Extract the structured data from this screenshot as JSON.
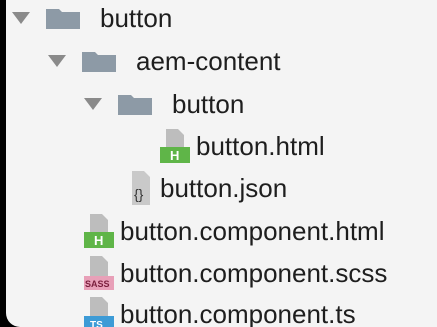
{
  "tree": {
    "root": {
      "label": "button"
    },
    "aem_content": {
      "label": "aem-content"
    },
    "button_folder": {
      "label": "button"
    },
    "button_html": {
      "label": "button.html",
      "badge": "H"
    },
    "button_json": {
      "label": "button.json",
      "badge": "{}"
    },
    "component_html": {
      "label": "button.component.html",
      "badge": "H"
    },
    "component_scss": {
      "label": "button.component.scss",
      "badge": "SASS"
    },
    "component_ts": {
      "label": "button.component.ts",
      "badge": "TS"
    }
  },
  "colors": {
    "folder": "#8d9aa6",
    "chevron": "#8a8a8a",
    "html_badge": "#5fb548",
    "sass_badge": "#e8a0b8",
    "ts_badge": "#3d9bd6"
  }
}
